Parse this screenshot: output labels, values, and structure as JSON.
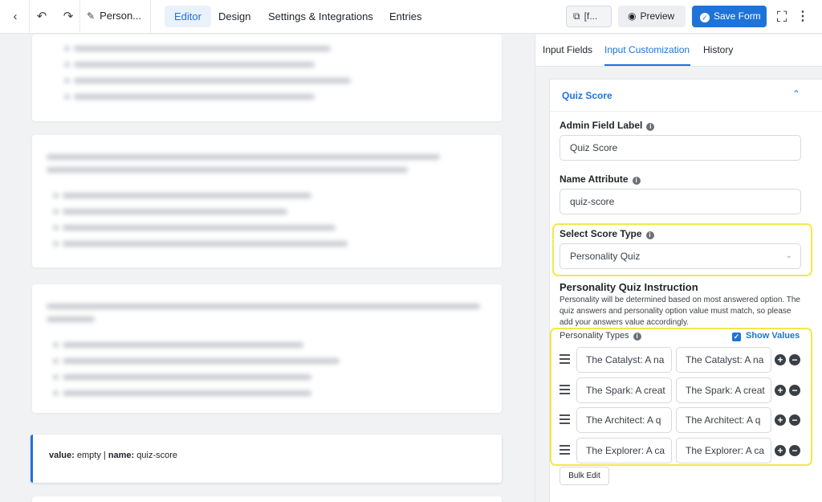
{
  "topbar": {
    "form_title": "Person...",
    "tabs": [
      {
        "label": "Editor",
        "active": true
      },
      {
        "label": "Design",
        "active": false
      },
      {
        "label": "Settings & Integrations",
        "active": false
      },
      {
        "label": "Entries",
        "active": false
      }
    ],
    "shortcode_label": "[f...",
    "preview_label": "Preview",
    "save_label": "Save Form",
    "accent_color": "#1e73d8"
  },
  "canvas": {
    "selected_field_info": {
      "value_key": "value:",
      "value_text": "empty",
      "separator": "|",
      "name_key": "name:",
      "name_text": "quiz-score"
    }
  },
  "panel": {
    "tabs": [
      {
        "label": "Input Fields",
        "active": false
      },
      {
        "label": "Input Customization",
        "active": true
      },
      {
        "label": "History",
        "active": false
      }
    ],
    "section_title": "Quiz Score",
    "admin_label": {
      "label": "Admin Field Label",
      "value": "Quiz Score"
    },
    "name_attribute": {
      "label": "Name Attribute",
      "value": "quiz-score"
    },
    "score_type": {
      "label": "Select Score Type",
      "value": "Personality Quiz"
    },
    "instruction": {
      "title": "Personality Quiz Instruction",
      "body": "Personality will be determined based on most answered option. The quiz answers and personality option value must match, so please add your answers value accordingly."
    },
    "personality_types": {
      "label": "Personality Types",
      "show_values_label": "Show Values",
      "show_values_checked": true,
      "rows": [
        {
          "label": "The Catalyst: A na",
          "value": "The Catalyst: A na"
        },
        {
          "label": "The Spark: A creat",
          "value": "The Spark: A creat"
        },
        {
          "label": "The Architect: A q",
          "value": "The Architect: A q"
        },
        {
          "label": "The Explorer: A ca",
          "value": "The Explorer: A ca"
        }
      ]
    },
    "bulk_edit_label": "Bulk Edit",
    "highlight_color": "#f2e84a"
  }
}
